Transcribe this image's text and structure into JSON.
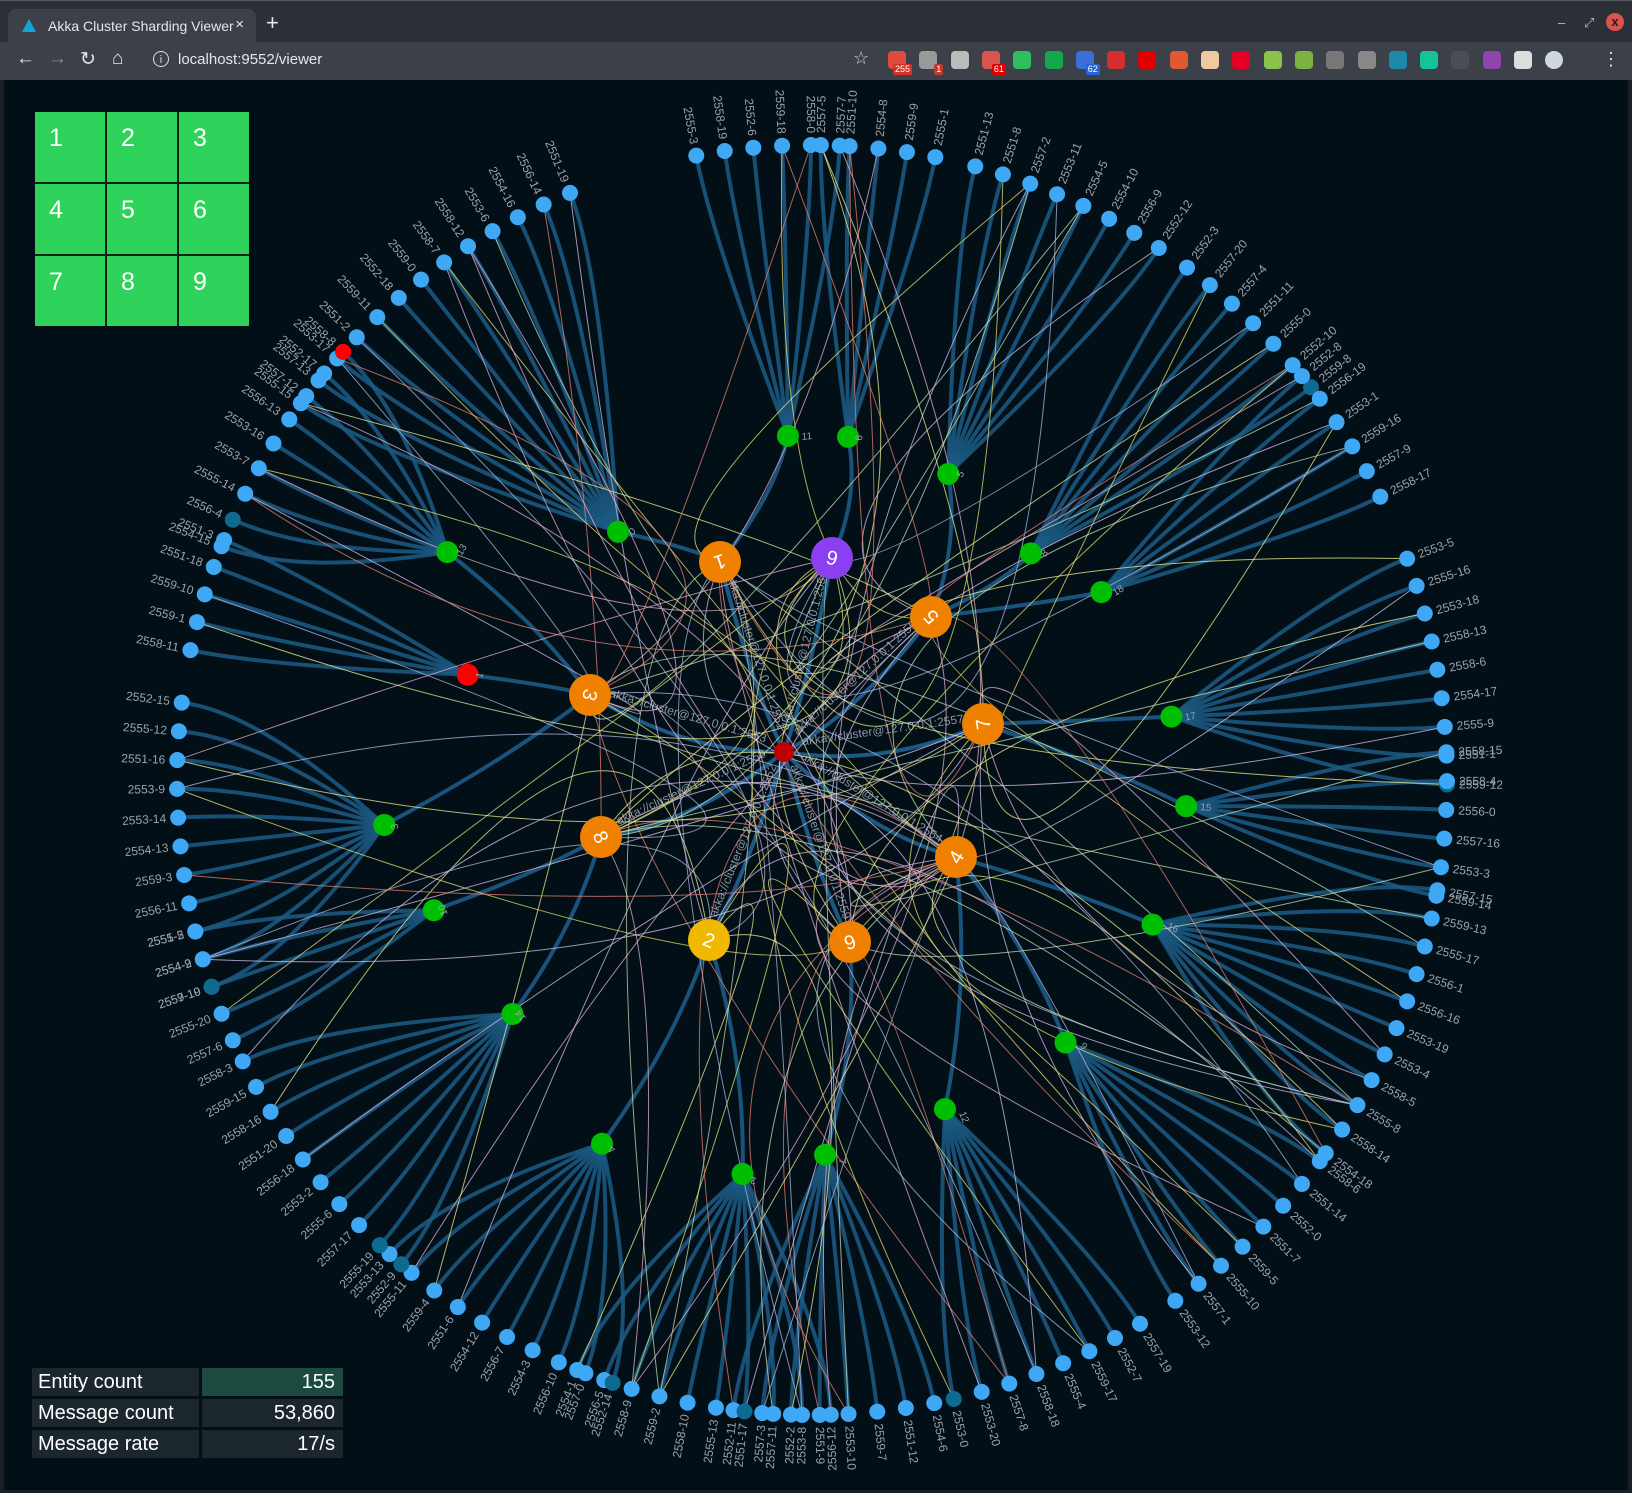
{
  "browser": {
    "tab_title": "Akka Cluster Sharding Viewer",
    "tab_close": "×",
    "new_tab": "+",
    "url": "localhost:9552/viewer",
    "window_controls": {
      "minimize": "–",
      "maximize": "⤢",
      "close": "x"
    },
    "nav": {
      "back": "←",
      "forward": "→",
      "reload": "↻",
      "home": "⌂",
      "info": "i",
      "star": "☆",
      "menu": "⋮"
    },
    "extensions": [
      {
        "name": "gmail-ext",
        "color": "#e04a3f",
        "badge": "255",
        "badge_color": "#d93025"
      },
      {
        "name": "opera-ext",
        "color": "#9a9a9a",
        "badge": "1",
        "badge_color": "#c0392b"
      },
      {
        "name": "settings-ext",
        "color": "#bbbbbb",
        "badge": ""
      },
      {
        "name": "stack-ext",
        "color": "#d9534f",
        "badge": "61",
        "badge_color": "#e00000"
      },
      {
        "name": "evernote-ext",
        "color": "#2dbe60",
        "badge": ""
      },
      {
        "name": "leaf-ext",
        "color": "#14a84c",
        "badge": ""
      },
      {
        "name": "tasks-ext",
        "color": "#3a6fd8",
        "badge": "62",
        "badge_color": "#2a63d4"
      },
      {
        "name": "mail-ext",
        "color": "#d32f2f",
        "badge": ""
      },
      {
        "name": "adblock-ext",
        "color": "#e00000",
        "badge": ""
      },
      {
        "name": "duckduckgo-ext",
        "color": "#de5833",
        "badge": ""
      },
      {
        "name": "face-ext",
        "color": "#f0c9a0",
        "badge": ""
      },
      {
        "name": "pinterest-ext",
        "color": "#e60023",
        "badge": ""
      },
      {
        "name": "leek-ext",
        "color": "#8bc34a",
        "badge": ""
      },
      {
        "name": "camera-ext",
        "color": "#7cb342",
        "badge": ""
      },
      {
        "name": "ring-ext",
        "color": "#777777",
        "badge": ""
      },
      {
        "name": "pocket-ext",
        "color": "#888888",
        "badge": ""
      },
      {
        "name": "notion-ext",
        "color": "#1e88a8",
        "badge": ""
      },
      {
        "name": "grammarly-ext",
        "color": "#15c39a",
        "badge": ""
      },
      {
        "name": "arrow-ext",
        "color": "#4a4e54",
        "badge": ""
      },
      {
        "name": "pen-ext",
        "color": "#8e44ad",
        "badge": ""
      },
      {
        "name": "puzzle-ext",
        "color": "#dddddd",
        "badge": ""
      },
      {
        "name": "profile-avatar",
        "color": "#cfd8dc",
        "badge": ""
      }
    ]
  },
  "grid": {
    "cells": [
      "1",
      "2",
      "3",
      "4",
      "5",
      "6",
      "7",
      "8",
      "9"
    ]
  },
  "stats": [
    {
      "label": "Entity count",
      "value": "155"
    },
    {
      "label": "Message count",
      "value": "53,860"
    },
    {
      "label": "Message rate",
      "value": "17/s"
    }
  ],
  "graph": {
    "colors": {
      "background": "#020f17",
      "entity": "#3ea8f5",
      "entity_idle": "#0e6b8f",
      "entity_alert": "#ff0000",
      "shard": "#00bf00",
      "shard_alert": "#ff0000",
      "cluster_node": "#f08000",
      "cluster_node_selected": "#f0b800",
      "cluster_node_special": "#8a3ff0",
      "root": "#c00000",
      "link": "#1c5a85",
      "label": "#9aa3aa"
    },
    "cluster_nodes": [
      {
        "id": "1",
        "address": "akka://cluster@127.0.0.1:2551",
        "color": "cluster_node"
      },
      {
        "id": "2",
        "address": "akka://cluster@127.0.0.1:2552",
        "color": "cluster_node_selected"
      },
      {
        "id": "3",
        "address": "akka://cluster@127.0.0.1:2553",
        "color": "cluster_node"
      },
      {
        "id": "4",
        "address": "akka://cluster@127.0.0.1:2554",
        "color": "cluster_node"
      },
      {
        "id": "5",
        "address": "akka://cluster@127.0.0.1:2555",
        "color": "cluster_node"
      },
      {
        "id": "6",
        "address": "akka://cluster@127.0.0.1:2556",
        "color": "cluster_node_special"
      },
      {
        "id": "7",
        "address": "akka://cluster@127.0.0.1:2557",
        "color": "cluster_node"
      },
      {
        "id": "8",
        "address": "akka://cluster@127.0.0.1:2558",
        "color": "cluster_node"
      },
      {
        "id": "9",
        "address": "akka://cluster@127.0.0.1:2559",
        "color": "cluster_node"
      }
    ],
    "root": {
      "label": "cluster"
    },
    "shards": [
      {
        "id": "0",
        "node": "1",
        "entities": [
          "2555-15",
          "2557-13",
          "2553-17",
          "2551-2",
          "2559-11",
          "2552-18",
          "2559-0",
          "2558-7",
          "2558-12",
          "2553-6",
          "2554-16",
          "2556-14",
          "2551-19"
        ]
      },
      {
        "id": "11",
        "node": "1",
        "entities": [
          "2555-3",
          "2558-19",
          "2552-6",
          "2559-18",
          "2558-0",
          "2557-7"
        ]
      },
      {
        "id": "6",
        "node": "6",
        "entities": [
          "2557-5",
          "2551-10",
          "2554-8",
          "2559-9",
          "2555-1"
        ]
      },
      {
        "id": "5",
        "node": "5",
        "entities": [
          "2551-13",
          "2551-8",
          "2557-2",
          "2553-11",
          "2554-5",
          "2554-10",
          "2556-9",
          "2552-12"
        ]
      },
      {
        "id": "8",
        "node": "5",
        "entities": [
          "2552-3",
          "2557-20",
          "2557-4",
          "2551-11",
          "2555-0",
          "2552-10",
          "2559-8"
        ]
      },
      {
        "id": "18",
        "node": "5",
        "entities": [
          "2552-8",
          "2556-19",
          "2553-1",
          "2559-16",
          "2557-9",
          "2558-17"
        ]
      },
      {
        "id": "17",
        "node": "7",
        "entities": [
          "2553-5",
          "2555-16",
          "2553-18",
          "2558-13",
          "2558-6",
          "2554-17",
          "2555-9",
          "2551-1",
          "2559-12"
        ]
      },
      {
        "id": "15",
        "node": "7",
        "entities": [
          "2558-15",
          "2558-4",
          "2556-0",
          "2557-16",
          "2553-3",
          "2559-14"
        ]
      },
      {
        "id": "16",
        "node": "4",
        "entities": [
          "2557-15",
          "2559-13",
          "2555-17",
          "2556-1",
          "2556-16",
          "2553-19",
          "2553-4",
          "2558-5",
          "2555-8",
          "2558-14",
          "2554-18"
        ]
      },
      {
        "id": "9",
        "node": "4",
        "entities": [
          "2558-6b",
          "2551-14",
          "2552-0",
          "2551-7",
          "2559-5",
          "2555-10",
          "2557-1",
          "2553-12"
        ]
      },
      {
        "id": "12",
        "node": "4",
        "entities": [
          "2557-19",
          "2552-7",
          "2559-17",
          "2555-4",
          "2558-18",
          "2557-8",
          "2553-20",
          "2553-0"
        ]
      },
      {
        "id": "7",
        "node": "9",
        "entities": [
          "2554-6",
          "2551-12",
          "2559-7",
          "2553-10",
          "2551-9",
          "2552-2",
          "2557-3",
          "2552-11"
        ]
      },
      {
        "id": "2",
        "node": "2",
        "entities": [
          "2556-12",
          "2553-8",
          "2557-11",
          "2551-17",
          "2555-13",
          "2558-10",
          "2559-2",
          "2558-9",
          "2556-5",
          "2554-1"
        ]
      },
      {
        "id": "4",
        "node": "2",
        "entities": [
          "2552-14",
          "2557-0",
          "2556-10",
          "2554-3",
          "2556-7",
          "2554-12",
          "2551-6",
          "2559-4",
          "2555-11",
          "2553-13"
        ]
      },
      {
        "id": "14",
        "node": "8",
        "entities": [
          "2552-9",
          "2555-19",
          "2557-17",
          "2555-6",
          "2553-2",
          "2556-18",
          "2551-20",
          "2558-16",
          "2559-15",
          "2558-3"
        ]
      },
      {
        "id": "10",
        "node": "8",
        "entities": [
          "2557-6",
          "2555-20",
          "2559-19",
          "2554-9",
          "2555-2"
        ]
      },
      {
        "id": "3",
        "node": "3",
        "entities": [
          "2557-10",
          "2554-2",
          "2551-5",
          "2556-11",
          "2559-3",
          "2554-13",
          "2553-14",
          "2553-9",
          "2551-16",
          "2555-12",
          "2552-15"
        ]
      },
      {
        "id": "1",
        "node": "3",
        "entities": [
          "2558-11",
          "2559-1",
          "2559-10",
          "2551-18",
          "2551-3"
        ]
      },
      {
        "id": "13",
        "node": "3",
        "entities": [
          "2554-15",
          "2556-4",
          "2555-14",
          "2553-7",
          "2553-16",
          "2556-13",
          "2557-12",
          "2552-17",
          "2558-8"
        ]
      }
    ],
    "entity_label_overrides": {
      "2558-6b": "2558-6"
    },
    "idle_entities": [
      "2556-4",
      "2557-10",
      "2552-9",
      "2555-19",
      "2552-14",
      "2551-17",
      "2553-0",
      "2559-8",
      "2559-12"
    ],
    "alert_entities": [
      "2558-8"
    ],
    "alert_shards": [
      "1"
    ]
  }
}
